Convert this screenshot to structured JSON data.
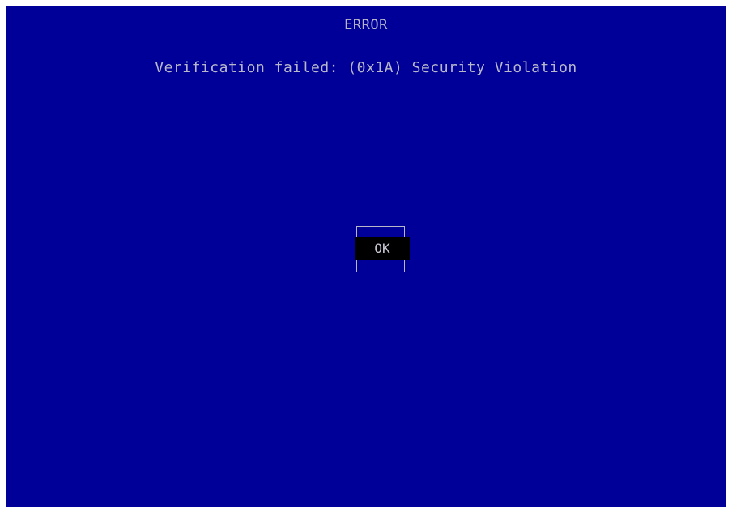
{
  "dialog": {
    "title": "ERROR",
    "message": "Verification failed: (0x1A) Security Violation",
    "ok_label": "OK"
  },
  "colors": {
    "background": "#000099",
    "text": "#b8b8c8",
    "button_bg": "#000000",
    "frame": "#ffffff"
  }
}
